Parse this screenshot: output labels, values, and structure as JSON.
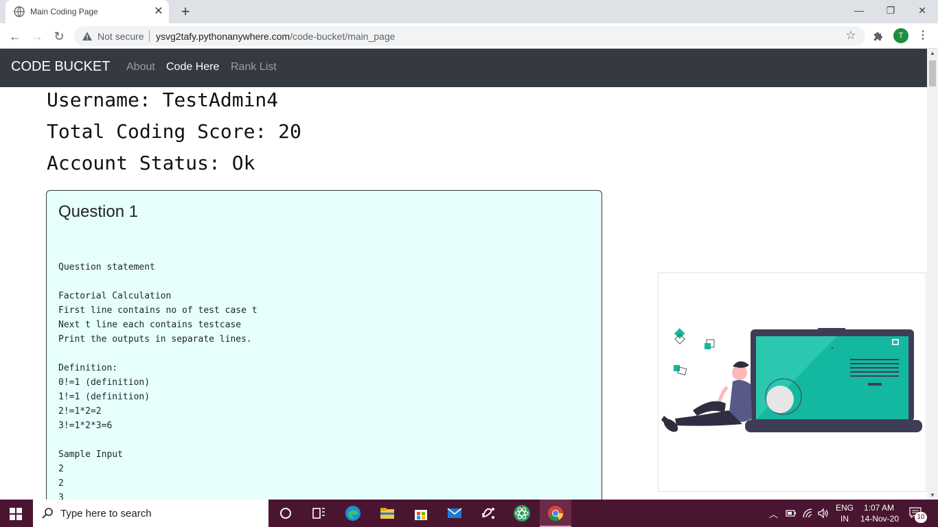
{
  "browser": {
    "tab_title": "Main Coding Page",
    "tab_close": "✕",
    "new_tab": "+",
    "security_label": "Not secure",
    "url_host": "ysvg2tafy.pythonanywhere.com",
    "url_path": "/code-bucket/main_page",
    "profile_initial": "T",
    "window_minimize": "—",
    "window_restore": "❐",
    "window_close": "✕"
  },
  "navbar": {
    "brand": "CODE BUCKET",
    "links": [
      {
        "label": "About",
        "active": false
      },
      {
        "label": "Code Here",
        "active": true
      },
      {
        "label": "Rank List",
        "active": false
      }
    ]
  },
  "profile": {
    "username_line": "Username: TestAdmin4",
    "score_line": "Total Coding Score: 20",
    "status_line": "Account Status: Ok"
  },
  "question": {
    "title": "Question 1",
    "body": "Question statement\n\nFactorial Calculation\nFirst line contains no of test case t\nNext t line each contains testcase\nPrint the outputs in separate lines.\n\nDefinition:\n0!=1 (definition)\n1!=1 (definition)\n2!=1*2=2\n3!=1*2*3=6\n\nSample Input\n2\n2\n3"
  },
  "taskbar": {
    "search_placeholder": "Type here to search",
    "lang_top": "ENG",
    "lang_bottom": "IN",
    "time": "1:07 AM",
    "date": "14-Nov-20",
    "notification_count": "10"
  },
  "colors": {
    "navbar_bg": "#343a40",
    "card_bg": "#e6fffd",
    "accent_teal": "#14b8a0",
    "taskbar_bg": "#4a1530"
  }
}
